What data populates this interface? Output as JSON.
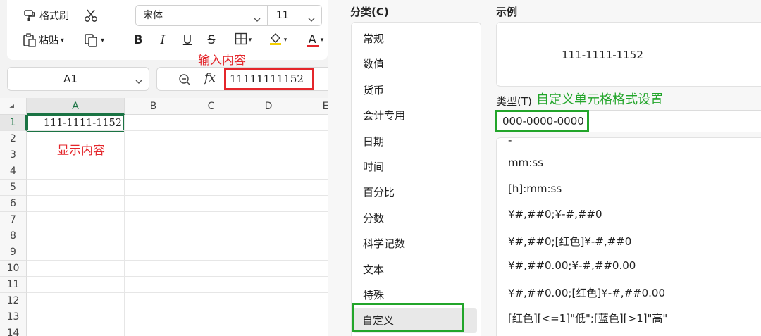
{
  "ribbon": {
    "format_painter": "格式刷",
    "paste": "粘贴",
    "font_name": "宋体",
    "font_size": "11",
    "bold": "B",
    "italic": "I",
    "underline": "U",
    "strikethrough": "S",
    "font_color_letter": "A",
    "font_color": "#e4262b",
    "fill_color": "#f5d000"
  },
  "formula_bar": {
    "name_box": "A1",
    "fx_label": "fx",
    "input_value": "11111111152"
  },
  "sheet": {
    "columns": [
      "A",
      "B",
      "C",
      "D",
      "E"
    ],
    "rows": [
      "1",
      "2",
      "3",
      "4",
      "5",
      "6",
      "7",
      "8",
      "9",
      "10",
      "11",
      "12",
      "13",
      "14"
    ],
    "cell_a1": "111-1111-1152",
    "active_cell_color": "#1a7343"
  },
  "annotations": {
    "input_content": "输入内容",
    "display_content": "显示内容",
    "custom_format_setting": "自定义单元格格式设置",
    "red": "#e4262b",
    "green": "#22a52a"
  },
  "dialog": {
    "category_title": "分类(C)",
    "categories": [
      "常规",
      "数值",
      "货币",
      "会计专用",
      "日期",
      "时间",
      "百分比",
      "分数",
      "科学记数",
      "文本",
      "特殊",
      "自定义"
    ],
    "selected_category": "自定义",
    "sample_title": "示例",
    "sample_value": "111-1111-1152",
    "type_label": "类型(T)",
    "type_value": "000-0000-0000",
    "format_list": [
      "-",
      "mm:ss",
      "[h]:mm:ss",
      "¥#,##0;¥-#,##0",
      "¥#,##0;[红色]¥-#,##0",
      "¥#,##0.00;¥-#,##0.00",
      "¥#,##0.00;[红色]¥-#,##0.00",
      "[红色][<=1]\"低\";[蓝色][>1]\"高\""
    ]
  }
}
